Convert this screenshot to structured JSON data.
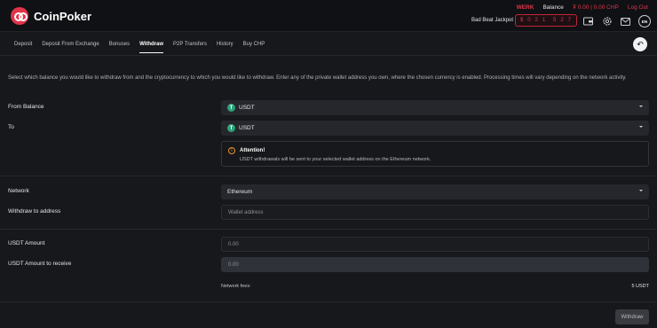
{
  "brand": {
    "name": "CoinPoker"
  },
  "account": {
    "username": "WERK",
    "balance_label": "Balance",
    "balance_value": "₮ 0.00  |  0.00 CHP",
    "logout": "Log Out"
  },
  "jackpot": {
    "label": "Bad Beat Jackpot",
    "digits": [
      "$",
      "0",
      "2",
      "1",
      "",
      "5",
      "2",
      "7"
    ]
  },
  "language": "EN",
  "tabs": [
    {
      "label": "Deposit"
    },
    {
      "label": "Deposit From Exchange"
    },
    {
      "label": "Bonuses"
    },
    {
      "label": "Withdraw",
      "active": true
    },
    {
      "label": "P2P Transfers"
    },
    {
      "label": "History"
    },
    {
      "label": "Buy CHP"
    }
  ],
  "intro": "Select which balance you would like to withdraw from and the cryptocurrency to which you would like to withdraw. Enter any of the private wallet address you own, where the chosen currency is enabled. Processing times will vary depending on the network activity.",
  "form": {
    "from_balance_label": "From Balance",
    "from_balance_value": "USDT",
    "to_label": "To",
    "to_value": "USDT",
    "notice_title": "Attention!",
    "notice_body": "USDT withdrawals will be sent to your selected wallet address on the Ethereum network.",
    "network_label": "Network",
    "network_value": "Ethereum",
    "address_label": "Withdraw to address",
    "address_placeholder": "Wallet address",
    "amount_label": "USDT Amount",
    "amount_placeholder": "0.00",
    "receive_label": "USDT Amount to receive",
    "receive_value": "0.00",
    "fees_label": "Network fees:",
    "fees_value": "5 USDT",
    "submit_label": "Withdraw"
  },
  "colors": {
    "accent": "#e0354b",
    "tether": "#2aa37a",
    "warning": "#e8922e"
  }
}
